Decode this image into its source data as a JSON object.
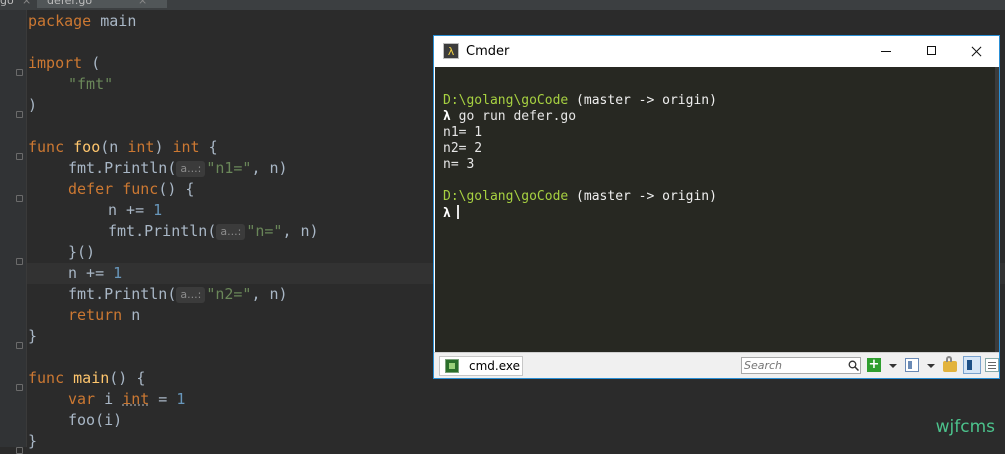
{
  "ide": {
    "tabs": [
      {
        "label": "go",
        "close": "×"
      },
      {
        "label": "defer.go",
        "close": "×"
      }
    ],
    "code": {
      "l1": {
        "kw": "package",
        "rest": " main"
      },
      "l3": {
        "kw": "import",
        "rest": " ("
      },
      "l4": {
        "str": "\"fmt\""
      },
      "l5": {
        "text": ")"
      },
      "l7": {
        "kw": "func",
        "name": "foo",
        "p1": "(n ",
        "type": "int",
        "p2": ") ",
        "ret": "int",
        "p3": " {"
      },
      "l8": {
        "pre": "fmt.Println(",
        "hint": "a...:",
        "str": "\"n1=\"",
        "post": ", n)"
      },
      "l9": {
        "kw1": "defer",
        "kw2": "func",
        "rest": "() {"
      },
      "l10": {
        "pre": "n += ",
        "num": "1"
      },
      "l11": {
        "pre": "fmt.Println(",
        "hint": "a...:",
        "str": "\"n=\"",
        "post": ", n)"
      },
      "l12": {
        "text": "}()"
      },
      "l13": {
        "pre": "n += ",
        "num": "1"
      },
      "l14": {
        "pre": "fmt.Println(",
        "hint": "a...:",
        "str": "\"n2=\"",
        "post": ", n)"
      },
      "l15": {
        "kw": "return",
        "rest": " n"
      },
      "l16": {
        "text": "}"
      },
      "l18": {
        "kw": "func",
        "name": "main",
        "rest": "() {"
      },
      "l19": {
        "kw": "var",
        "mid": " i ",
        "type": "int",
        "eq": " = ",
        "num": "1"
      },
      "l20": {
        "text": "foo(i)"
      },
      "l21": {
        "text": "}"
      }
    },
    "watermark": "wjfcms"
  },
  "cmder": {
    "icon_glyph": "λ",
    "title": "Cmder",
    "terminal": {
      "prompt_path": "D:\\golang\\goCode",
      "prompt_git": " (master -> origin)",
      "lambda": "λ",
      "command": " go run defer.go",
      "output": [
        "n1= 1",
        "n2= 2",
        "n= 3"
      ]
    },
    "status": {
      "console_tab": "cmd.exe",
      "search_placeholder": "Search",
      "add_glyph": "+"
    }
  }
}
